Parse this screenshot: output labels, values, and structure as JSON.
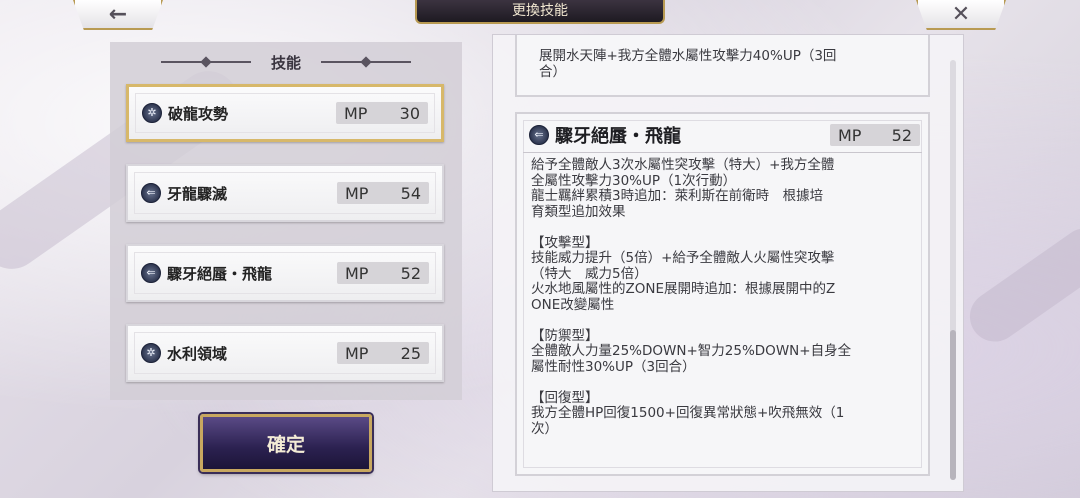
{
  "header": {
    "title": "更換技能",
    "back_icon": "←",
    "close_icon": "✕"
  },
  "skills_panel": {
    "heading": "技能",
    "items": [
      {
        "name": "破龍攻勢",
        "mp_label": "MP",
        "mp": "30",
        "icon": "✲",
        "selected": true
      },
      {
        "name": "牙龍驟滅",
        "mp_label": "MP",
        "mp": "54",
        "icon": "⇐",
        "selected": false
      },
      {
        "name": "驟牙絕蜃・飛龍",
        "mp_label": "MP",
        "mp": "52",
        "icon": "⇐",
        "selected": false
      },
      {
        "name": "水利領域",
        "mp_label": "MP",
        "mp": "25",
        "icon": "✲",
        "selected": false
      }
    ]
  },
  "confirm_button": {
    "label": "確定"
  },
  "detail_panel": {
    "prev_card_text": "展開水天陣+我方全體水屬性攻擊力40%UP（3回\n合）",
    "card": {
      "icon": "⇐",
      "title": "驟牙絕蜃・飛龍",
      "mp_label": "MP",
      "mp": "52",
      "description": "給予全體敵人3次水屬性突攻擊（特大）+我方全體\n全屬性攻擊力30%UP（1次行動）\n龍士羈絆累積3時追加：萊利斯在前衛時　根據培\n育類型追加效果\n\n【攻擊型】\n技能威力提升（5倍）+給予全體敵人火屬性突攻擊\n（特大　威力5倍）\n火水地風屬性的ZONE展開時追加：根據展開中的Z\nONE改變屬性\n\n【防禦型】\n全體敵人力量25%DOWN+智力25%DOWN+自身全\n屬性耐性30%UP（3回合）\n\n【回復型】\n我方全體HP回復1500+回復異常狀態+吹飛無效（1\n次）"
    }
  }
}
